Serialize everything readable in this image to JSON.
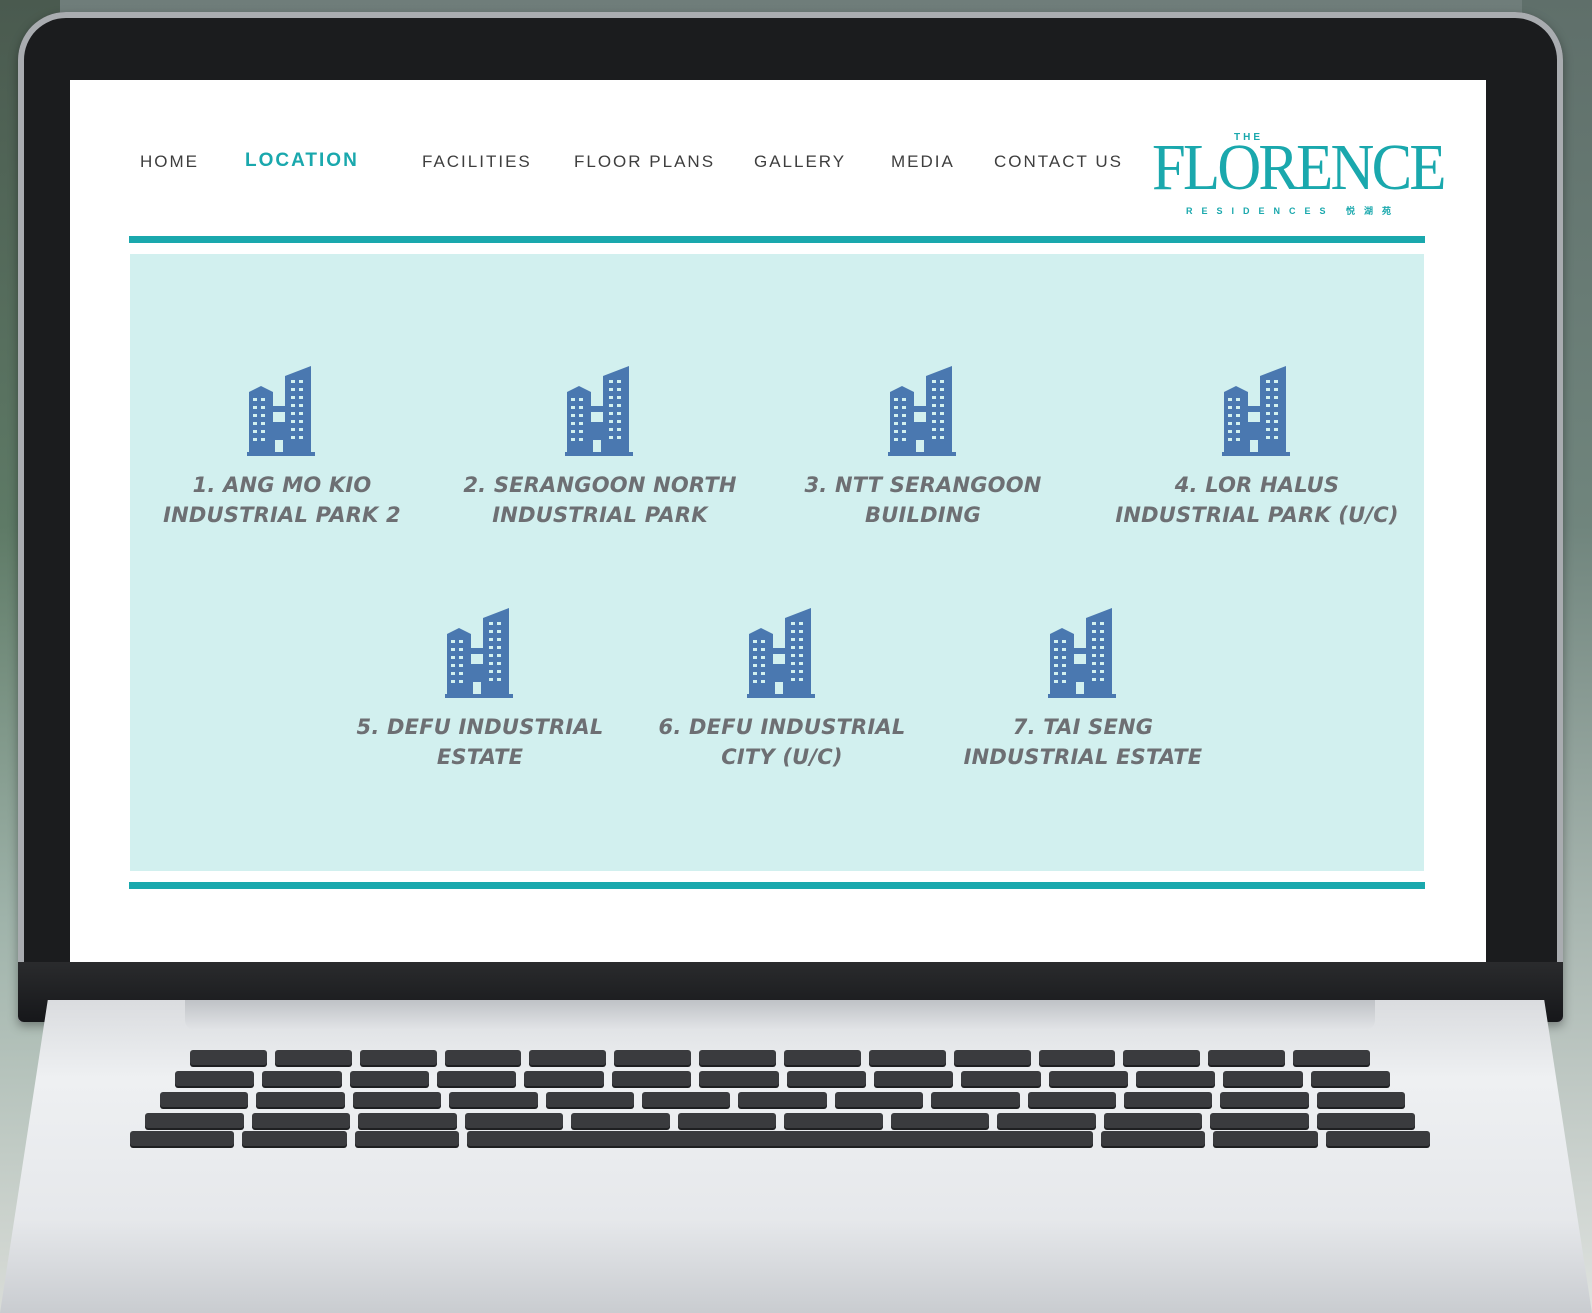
{
  "nav": {
    "items": [
      {
        "label": "HOME"
      },
      {
        "label": "LOCATION"
      },
      {
        "label": "FACILITIES"
      },
      {
        "label": "FLOOR PLANS"
      },
      {
        "label": "GALLERY"
      },
      {
        "label": "MEDIA"
      },
      {
        "label": "CONTACT US"
      }
    ],
    "active": "LOCATION"
  },
  "logo": {
    "the": "THE",
    "word": "FLORENCE",
    "sub": "RESIDENCES 悦湖苑"
  },
  "locations": [
    {
      "line1": "1. ANG MO KIO",
      "line2": "INDUSTRIAL PARK 2",
      "icon": "building-icon"
    },
    {
      "line1": "2. SERANGOON NORTH",
      "line2": "INDUSTRIAL PARK",
      "icon": "building-icon"
    },
    {
      "line1": "3. NTT SERANGOON",
      "line2": "BUILDING",
      "icon": "building-icon"
    },
    {
      "line1": "4. LOR HALUS",
      "line2": "INDUSTRIAL PARK (U/C)",
      "icon": "building-icon"
    },
    {
      "line1": "5. DEFU INDUSTRIAL",
      "line2": "ESTATE",
      "icon": "building-icon"
    },
    {
      "line1": "6. DEFU INDUSTRIAL",
      "line2": "CITY (U/C)",
      "icon": "building-icon"
    },
    {
      "line1": "7. TAI SENG",
      "line2": "INDUSTRIAL ESTATE",
      "icon": "building-icon"
    }
  ],
  "colors": {
    "accent": "#1aa8ad",
    "panel": "#d2f0ef",
    "icon": "#4a78b0",
    "label": "#6d6f73"
  }
}
